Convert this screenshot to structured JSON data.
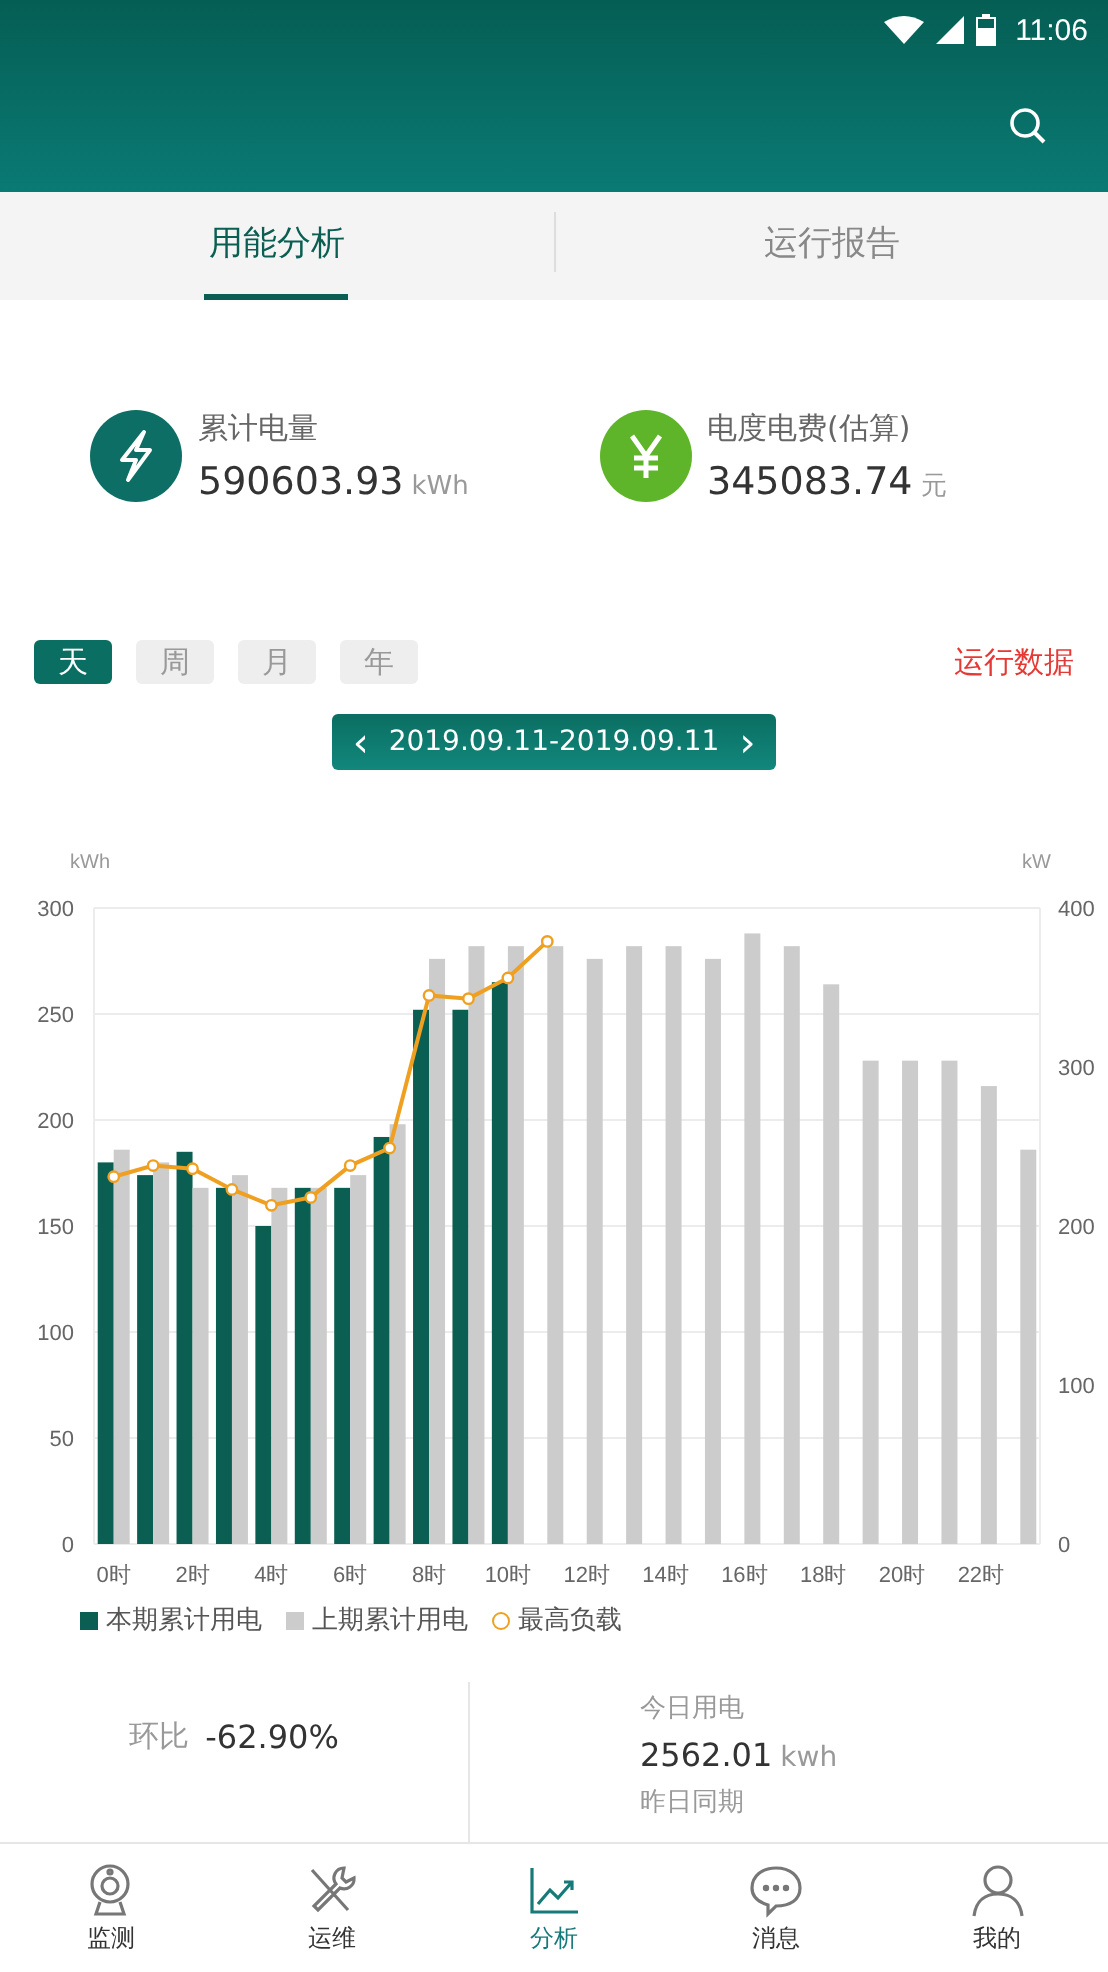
{
  "status_bar": {
    "time": "11:06"
  },
  "tabs": [
    {
      "label": "用能分析",
      "selected": true
    },
    {
      "label": "运行报告",
      "selected": false
    }
  ],
  "summary": [
    {
      "kind": "energy",
      "label": "累计电量",
      "value": "590603.93",
      "unit": "kWh"
    },
    {
      "kind": "cost",
      "label": "电度电费(估算)",
      "value": "345083.74",
      "unit": "元"
    }
  ],
  "periods": [
    {
      "label": "天",
      "selected": true
    },
    {
      "label": "周",
      "selected": false
    },
    {
      "label": "月",
      "selected": false
    },
    {
      "label": "年",
      "selected": false
    }
  ],
  "run_data_link": "运行数据",
  "date_range": {
    "prev": "‹",
    "label": "2019.09.11-2019.09.11",
    "next": "›"
  },
  "charts": [
    {
      "chart_data": {
        "type": "bar",
        "ylabel": "kWh",
        "x": [
          0,
          1,
          2,
          3,
          4,
          5,
          6,
          7,
          8,
          9,
          10,
          11,
          12,
          13,
          14,
          15,
          16,
          17,
          18,
          19,
          20,
          21,
          22,
          23
        ],
        "xlim": [
          -0.5,
          23.5
        ],
        "ylim": [
          0,
          300
        ],
        "yticks": [
          0,
          50,
          100,
          150,
          200,
          250,
          300
        ],
        "grid": true,
        "legend": "bottom",
        "xticks": [
          {
            "value": 0,
            "label": "0时"
          },
          {
            "value": 2,
            "label": "2时"
          },
          {
            "value": 4,
            "label": "4时"
          },
          {
            "value": 6,
            "label": "6时"
          },
          {
            "value": 8,
            "label": "8时"
          },
          {
            "value": 10,
            "label": "10时"
          },
          {
            "value": 12,
            "label": "12时"
          },
          {
            "value": 14,
            "label": "14时"
          },
          {
            "value": 16,
            "label": "16时"
          },
          {
            "value": 18,
            "label": "18时"
          },
          {
            "value": 20,
            "label": "20时"
          },
          {
            "value": 22,
            "label": "22时"
          }
        ],
        "series": [
          {
            "name": "本期累计用电",
            "color": "#0b5e52",
            "values": [
              180,
              174,
              185,
              168,
              150,
              168,
              168,
              192,
              252,
              252,
              265,
              null,
              null,
              null,
              null,
              null,
              null,
              null,
              null,
              null,
              null,
              null,
              null,
              null
            ]
          },
          {
            "name": "上期累计用电",
            "color": "#cccccc",
            "values": [
              186,
              180,
              168,
              174,
              168,
              168,
              174,
              198,
              276,
              282,
              282,
              282,
              276,
              282,
              282,
              276,
              288,
              282,
              264,
              228,
              228,
              228,
              216,
              186
            ]
          }
        ]
      }
    },
    {
      "chart_data": {
        "type": "line",
        "ylabel": "kW",
        "x": [
          0,
          1,
          2,
          3,
          4,
          5,
          6,
          7,
          8,
          9,
          10,
          11
        ],
        "xlim": [
          -0.5,
          23.5
        ],
        "ylim": [
          0,
          400
        ],
        "yticks": [
          0,
          100,
          200,
          300,
          400
        ],
        "series": [
          {
            "name": "最高负载",
            "color": "#f0a020",
            "marker": "circle",
            "values": [
              231,
              238,
              236,
              223,
              213,
              218,
              238,
              249,
              345,
              343,
              356,
              379
            ]
          }
        ]
      }
    }
  ],
  "ratio": {
    "label": "环比",
    "value": "-62.90%"
  },
  "today": {
    "label": "今日用电",
    "value": "2562.01",
    "unit": "kwh",
    "compare_label": "昨日同期"
  },
  "nav": [
    {
      "kind": "monitor",
      "label": "监测",
      "selected": false
    },
    {
      "kind": "tools",
      "label": "运维",
      "selected": false
    },
    {
      "kind": "chart",
      "label": "分析",
      "selected": true
    },
    {
      "kind": "chat",
      "label": "消息",
      "selected": false
    },
    {
      "kind": "user",
      "label": "我的",
      "selected": false
    }
  ]
}
